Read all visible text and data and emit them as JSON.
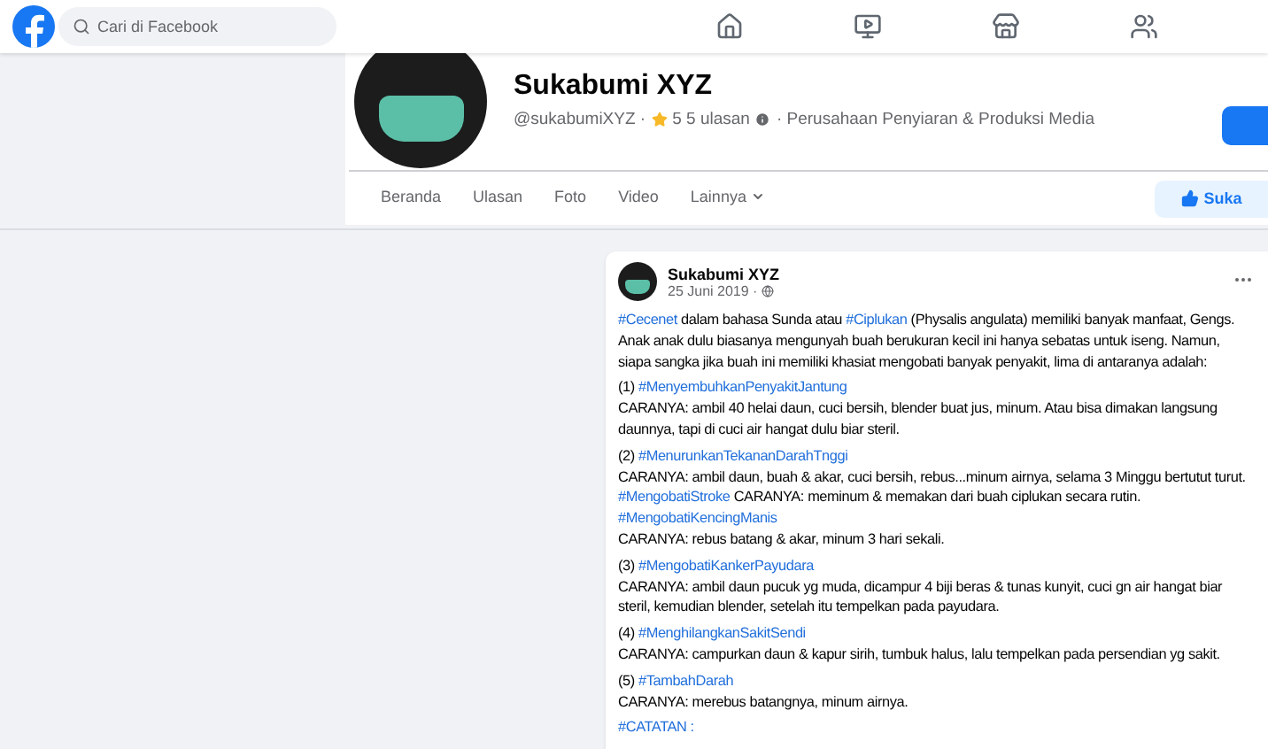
{
  "topbar": {
    "search": {
      "placeholder": "Cari di Facebook"
    }
  },
  "page": {
    "name": "Sukabumi XYZ",
    "handle": "@sukabumiXYZ ·",
    "rating": "5",
    "reviews": "5 ulasan",
    "category": "· Perusahaan Penyiaran & Produksi Media"
  },
  "tabs": [
    {
      "label": "Beranda",
      "selected": false,
      "kind": "tab"
    },
    {
      "label": "Ulasan",
      "selected": false,
      "kind": "tab"
    },
    {
      "label": "Foto",
      "selected": false,
      "kind": "tab"
    },
    {
      "label": "Video",
      "selected": false,
      "kind": "tab"
    },
    {
      "label": "Lainnya",
      "selected": false,
      "kind": "menu"
    }
  ],
  "like_button": {
    "label": "Suka"
  },
  "post": {
    "author": "Sukabumi XYZ",
    "date": "25 Juni 2019 ·",
    "paragraphs": [
      [
        [
          {
            "text": "#Cecenet",
            "link": true
          },
          {
            "text": " dalam bahasa Sunda atau ",
            "link": false
          },
          {
            "text": "#Ciplukan",
            "link": true
          },
          {
            "text": " (Physalis angulata) memiliki banyak manfaat, Gengs. Anak anak dulu biasanya mengunyah buah berukuran kecil ini hanya sebatas untuk iseng. Namun, siapa sangka jika buah ini memiliki khasiat mengobati banyak penyakit, lima di antaranya adalah:",
            "link": false
          }
        ]
      ],
      [
        [
          {
            "text": "(1) ",
            "link": false
          },
          {
            "text": "#MenyembuhkanPenyakitJantung",
            "link": true
          }
        ],
        [
          {
            "text": "CARANYA: ambil 40 helai daun, cuci bersih, blender buat jus, minum. Atau bisa dimakan langsung daunnya, tapi di cuci air hangat dulu biar steril.",
            "link": false
          }
        ]
      ],
      [
        [
          {
            "text": "(2) ",
            "link": false
          },
          {
            "text": "#MenurunkanTekananDarahTnggi",
            "link": true
          }
        ],
        [
          {
            "text": "CARANYA: ambil daun, buah & akar, cuci bersih, rebus...minum airnya, selama 3 Minggu bertutut turut. ",
            "link": false
          },
          {
            "text": "#MengobatiStroke",
            "link": true
          },
          {
            "text": " CARANYA: meminum & memakan dari buah ciplukan secara rutin.",
            "link": false
          }
        ],
        [
          {
            "text": "#MengobatiKencingManis",
            "link": true
          }
        ],
        [
          {
            "text": "CARANYA: rebus batang & akar, minum 3 hari sekali.",
            "link": false
          }
        ]
      ],
      [
        [
          {
            "text": "(3) ",
            "link": false
          },
          {
            "text": "#MengobatiKankerPayudara",
            "link": true
          }
        ],
        [
          {
            "text": "CARANYA: ambil daun pucuk yg muda, dicampur 4 biji beras & tunas kunyit, cuci gn air hangat biar steril, kemudian blender, setelah itu tempelkan pada payudara.",
            "link": false
          }
        ]
      ],
      [
        [
          {
            "text": "(4) ",
            "link": false
          },
          {
            "text": "#MenghilangkanSakitSendi",
            "link": true
          }
        ],
        [
          {
            "text": "CARANYA: campurkan daun & kapur sirih, tumbuk halus, lalu tempelkan pada persendian yg sakit.",
            "link": false
          }
        ]
      ],
      [
        [
          {
            "text": "(5) ",
            "link": false
          },
          {
            "text": "#TambahDarah",
            "link": true
          }
        ],
        [
          {
            "text": "CARANYA: merebus batangnya, minum airnya.",
            "link": false
          }
        ]
      ],
      [
        [
          {
            "text": "#CATATAN :",
            "link": true
          }
        ]
      ]
    ]
  }
}
